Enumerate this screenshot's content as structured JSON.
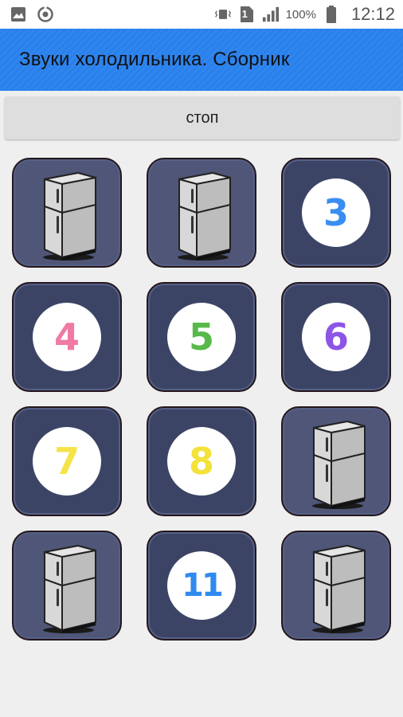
{
  "status_bar": {
    "battery_percent": "100%",
    "time": "12:12",
    "sim_label": "1",
    "icons": [
      "image-icon",
      "sync-icon",
      "vibrate-icon",
      "sim-icon",
      "signal-icon",
      "battery-icon"
    ]
  },
  "app_bar": {
    "title": "Звуки холодильника. Сборник"
  },
  "stop_button": {
    "label": "стоп"
  },
  "tiles": [
    {
      "type": "fridge",
      "icon": "fridge-icon"
    },
    {
      "type": "fridge",
      "icon": "fridge-icon"
    },
    {
      "type": "number",
      "label": "3",
      "color": "#3a8ef2"
    },
    {
      "type": "number",
      "label": "4",
      "color": "#f07aa5"
    },
    {
      "type": "number",
      "label": "5",
      "color": "#58b94b"
    },
    {
      "type": "number",
      "label": "6",
      "color": "#8d55e6"
    },
    {
      "type": "number",
      "label": "7",
      "color": "#f5e34a"
    },
    {
      "type": "number",
      "label": "8",
      "color": "#f2e23a"
    },
    {
      "type": "fridge",
      "icon": "fridge-icon"
    },
    {
      "type": "fridge",
      "icon": "fridge-icon"
    },
    {
      "type": "number",
      "label": "11",
      "color": "#2f8af0"
    },
    {
      "type": "fridge",
      "icon": "fridge-icon"
    }
  ],
  "colors": {
    "app_bar": "#2f86ef",
    "tile_background": "#3c4466",
    "background": "#efefef"
  }
}
